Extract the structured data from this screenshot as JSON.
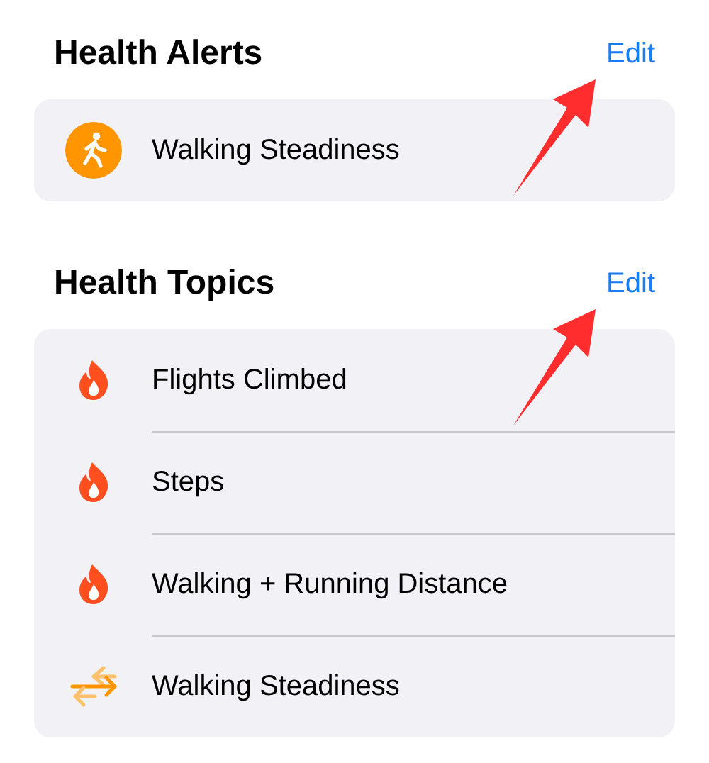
{
  "sections": [
    {
      "title": "Health Alerts",
      "action": "Edit",
      "items": [
        {
          "kind": "walk-badge",
          "label": "Walking Steadiness"
        }
      ]
    },
    {
      "title": "Health Topics",
      "action": "Edit",
      "items": [
        {
          "kind": "flame",
          "label": "Flights Climbed"
        },
        {
          "kind": "flame",
          "label": "Steps"
        },
        {
          "kind": "flame",
          "label": "Walking + Running Distance"
        },
        {
          "kind": "arrows",
          "label": "Walking Steadiness"
        }
      ]
    }
  ]
}
